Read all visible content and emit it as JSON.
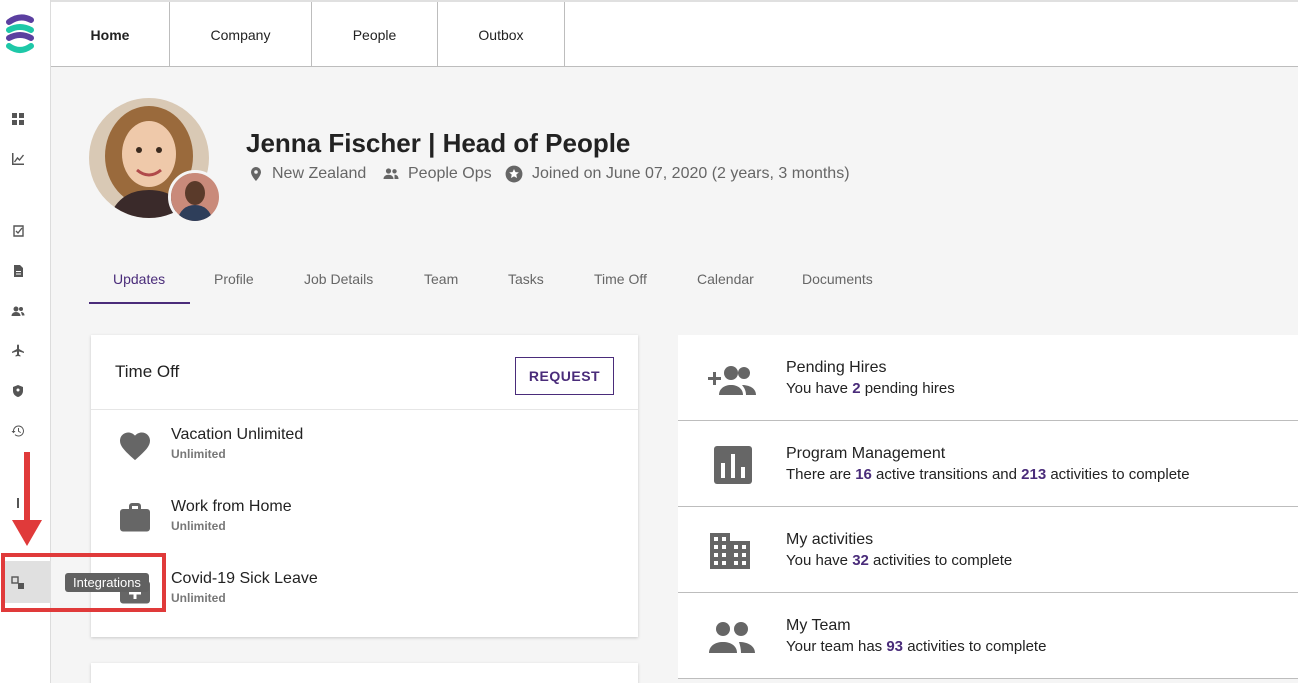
{
  "top_nav": {
    "tabs": [
      {
        "label": "Home"
      },
      {
        "label": "Company"
      },
      {
        "label": "People"
      },
      {
        "label": "Outbox"
      }
    ]
  },
  "sidebar": {
    "icons": [
      "dashboard-icon",
      "chart-icon",
      "checklist-icon",
      "document-icon",
      "people-icon",
      "airplane-icon",
      "shield-icon",
      "history-icon",
      "integrations-icon"
    ],
    "tooltip": "Integrations"
  },
  "profile": {
    "name": "Jenna Fischer | Head of People",
    "location": "New Zealand",
    "department": "People Ops",
    "joined": "Joined on June 07, 2020 (2 years, 3 months)"
  },
  "profile_tabs": [
    {
      "label": "Updates"
    },
    {
      "label": "Profile"
    },
    {
      "label": "Job Details"
    },
    {
      "label": "Team"
    },
    {
      "label": "Tasks"
    },
    {
      "label": "Time Off"
    },
    {
      "label": "Calendar"
    },
    {
      "label": "Documents"
    }
  ],
  "time_off": {
    "title": "Time Off",
    "request_label": "REQUEST",
    "items": [
      {
        "name": "Vacation Unlimited",
        "sub": "Unlimited",
        "icon": "heart-icon"
      },
      {
        "name": "Work from Home",
        "sub": "Unlimited",
        "icon": "briefcase-icon"
      },
      {
        "name": "Covid-19 Sick Leave",
        "sub": "Unlimited",
        "icon": "medical-bag-icon"
      }
    ]
  },
  "stats": [
    {
      "title": "Pending Hires",
      "pre": "You have ",
      "num1": "2",
      "mid": " pending hires",
      "num2": "",
      "post": "",
      "icon": "add-people-icon"
    },
    {
      "title": "Program Management",
      "pre": "There are ",
      "num1": "16",
      "mid": " active transitions and ",
      "num2": "213",
      "post": " activities to complete",
      "icon": "bar-chart-icon"
    },
    {
      "title": "My activities",
      "pre": "You have ",
      "num1": "32",
      "mid": " activities to complete",
      "num2": "",
      "post": "",
      "icon": "building-icon"
    },
    {
      "title": "My Team",
      "pre": "Your team has ",
      "num1": "93",
      "mid": " activities to complete",
      "num2": "",
      "post": "",
      "icon": "group-icon"
    }
  ],
  "colors": {
    "accent": "#4a2c7a",
    "annotation": "#e03a3a",
    "logo_teal": "#1ec8a8",
    "logo_purple": "#5b3fa0"
  }
}
